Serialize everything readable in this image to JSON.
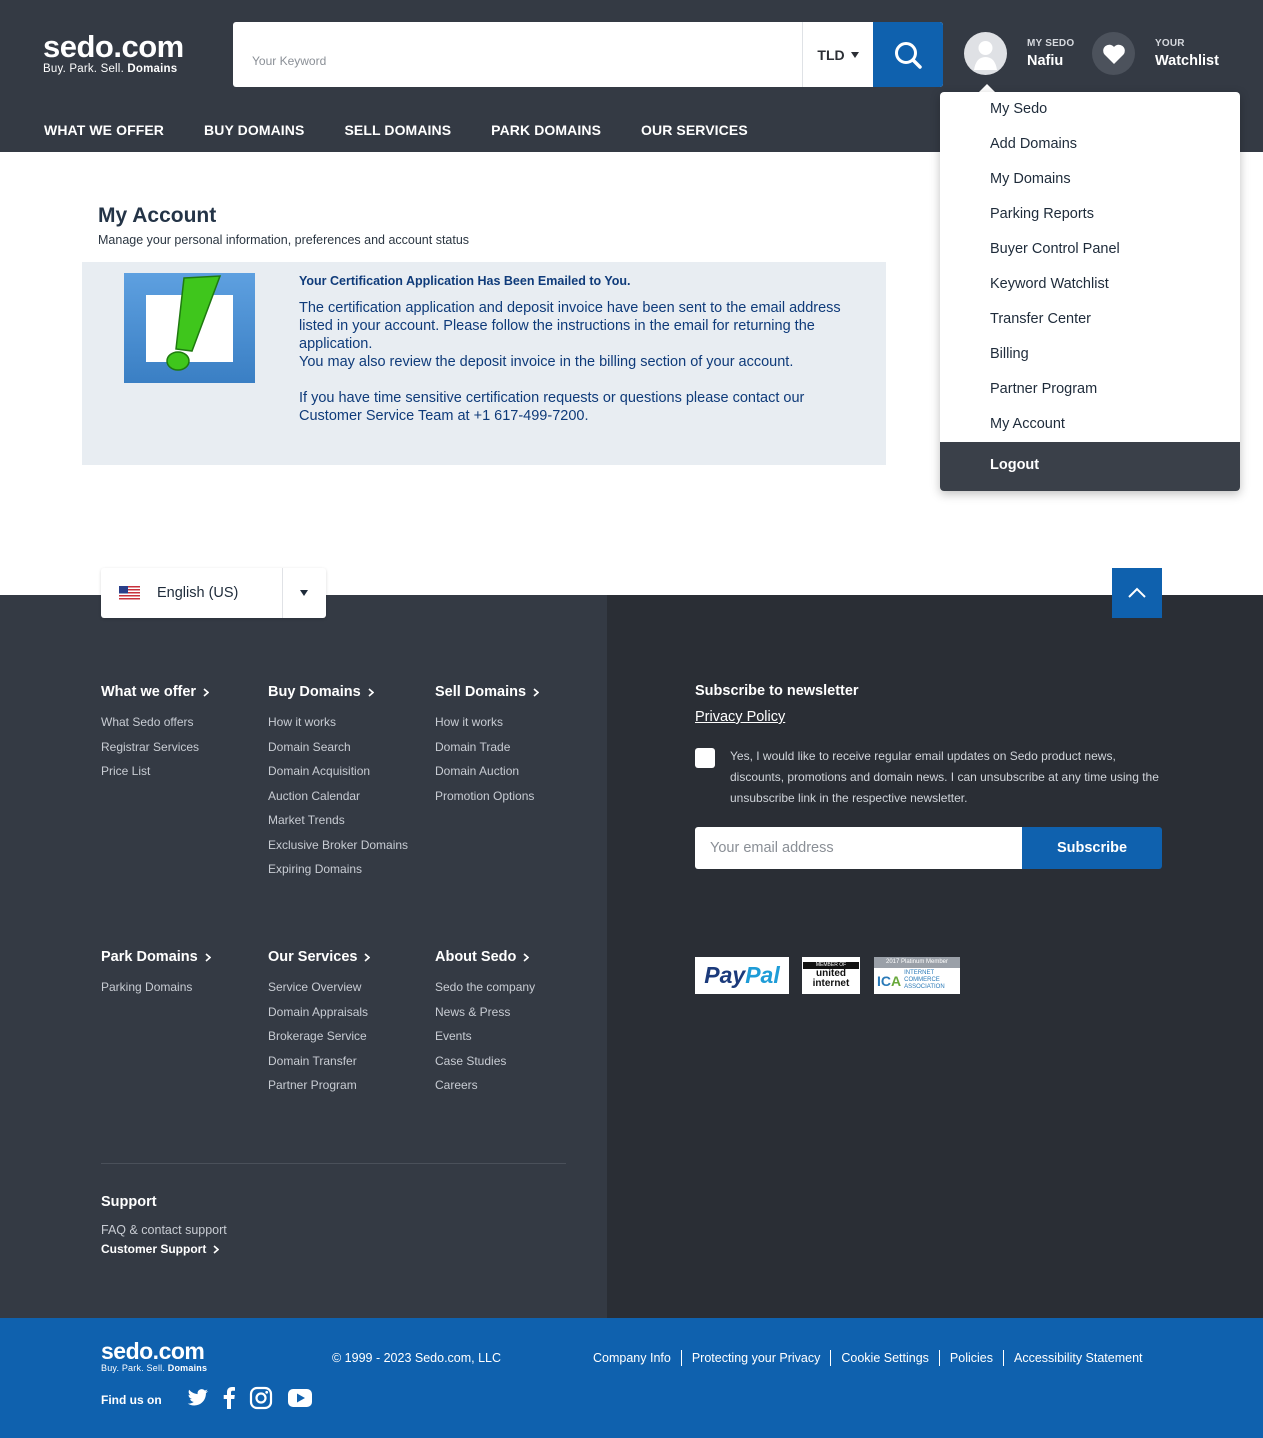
{
  "header": {
    "logo_main": "sedo.com",
    "logo_tag_plain": "Buy.  Park.  Sell.",
    "logo_tag_bold": "Domains",
    "search_placeholder": "Your Keyword",
    "tld_label": "TLD",
    "my_sedo_small": "MY SEDO",
    "my_sedo_user": "Nafiu",
    "watchlist_small": "YOUR",
    "watchlist_label": "Watchlist",
    "nav": [
      "WHAT WE OFFER",
      "BUY DOMAINS",
      "SELL DOMAINS",
      "PARK DOMAINS",
      "OUR SERVICES"
    ]
  },
  "dropdown": {
    "items": [
      "My Sedo",
      "Add Domains",
      "My Domains",
      "Parking Reports",
      "Buyer Control Panel",
      "Keyword Watchlist",
      "Transfer Center",
      "Billing",
      "Partner Program",
      "My Account"
    ],
    "logout": "Logout"
  },
  "main": {
    "title": "My Account",
    "subtitle": "Manage your personal information, preferences and account status",
    "notice": {
      "heading": "Your Certification Application Has Been Emailed to You.",
      "p1": "The certification application and deposit invoice have been sent to the email address listed in your account. Please follow the instructions in the email for returning the application.",
      "p2": "You may also review the deposit invoice in the billing section of your account.",
      "p3": "If you have time sensitive certification requests or questions please contact our Customer Service Team at +1 617-499-7200."
    }
  },
  "footer": {
    "language": "English (US)",
    "columns": [
      {
        "title": "What we offer",
        "links": [
          "What Sedo offers",
          "Registrar Services",
          "Price List"
        ]
      },
      {
        "title": "Buy Domains",
        "links": [
          "How it works",
          "Domain Search",
          "Domain Acquisition",
          "Auction Calendar",
          "Market Trends",
          "Exclusive Broker Domains",
          "Expiring Domains"
        ]
      },
      {
        "title": "Sell Domains",
        "links": [
          "How it works",
          "Domain Trade",
          "Domain Auction",
          "Promotion Options"
        ]
      },
      {
        "title": "Park Domains",
        "links": [
          "Parking Domains"
        ]
      },
      {
        "title": "Our Services",
        "links": [
          "Service Overview",
          "Domain Appraisals",
          "Brokerage Service",
          "Domain Transfer",
          "Partner Program"
        ]
      },
      {
        "title": "About Sedo",
        "links": [
          "Sedo the company",
          "News & Press",
          "Events",
          "Case Studies",
          "Careers"
        ]
      }
    ],
    "support": {
      "title": "Support",
      "faq": "FAQ & contact support",
      "customer_support": "Customer Support"
    },
    "newsletter": {
      "title": "Subscribe to newsletter",
      "privacy": "Privacy Policy",
      "consent": "Yes, I would like to receive regular email updates on Sedo product news, discounts, promotions and domain news. I can unsubscribe at any time using the unsubscribe link in the respective newsletter.",
      "email_placeholder": "Your email address",
      "subscribe": "Subscribe"
    },
    "badges": {
      "paypal_a": "Pay",
      "paypal_b": "Pal",
      "ui_top": "MEMBER OF",
      "ui_main": "united internet",
      "ica_top": "2017 Platinum Member",
      "ica_logo_a": "IC",
      "ica_logo_b": "A",
      "ica_text": "INTERNET COMMERCE ASSOCIATION"
    }
  },
  "bottom": {
    "copyright": "© 1999 - 2023 Sedo.com, LLC",
    "links": [
      "Company Info",
      "Protecting your Privacy",
      "Cookie Settings",
      "Policies",
      "Accessibility Statement"
    ],
    "find_us": "Find us on",
    "social_icons": [
      "twitter-icon",
      "facebook-icon",
      "instagram-icon",
      "youtube-icon"
    ]
  },
  "colors": {
    "header_bg": "#343a44",
    "accent_blue": "#0f61ae",
    "notice_bg": "#e8edf2",
    "footer_right_bg": "#2a2e35"
  }
}
